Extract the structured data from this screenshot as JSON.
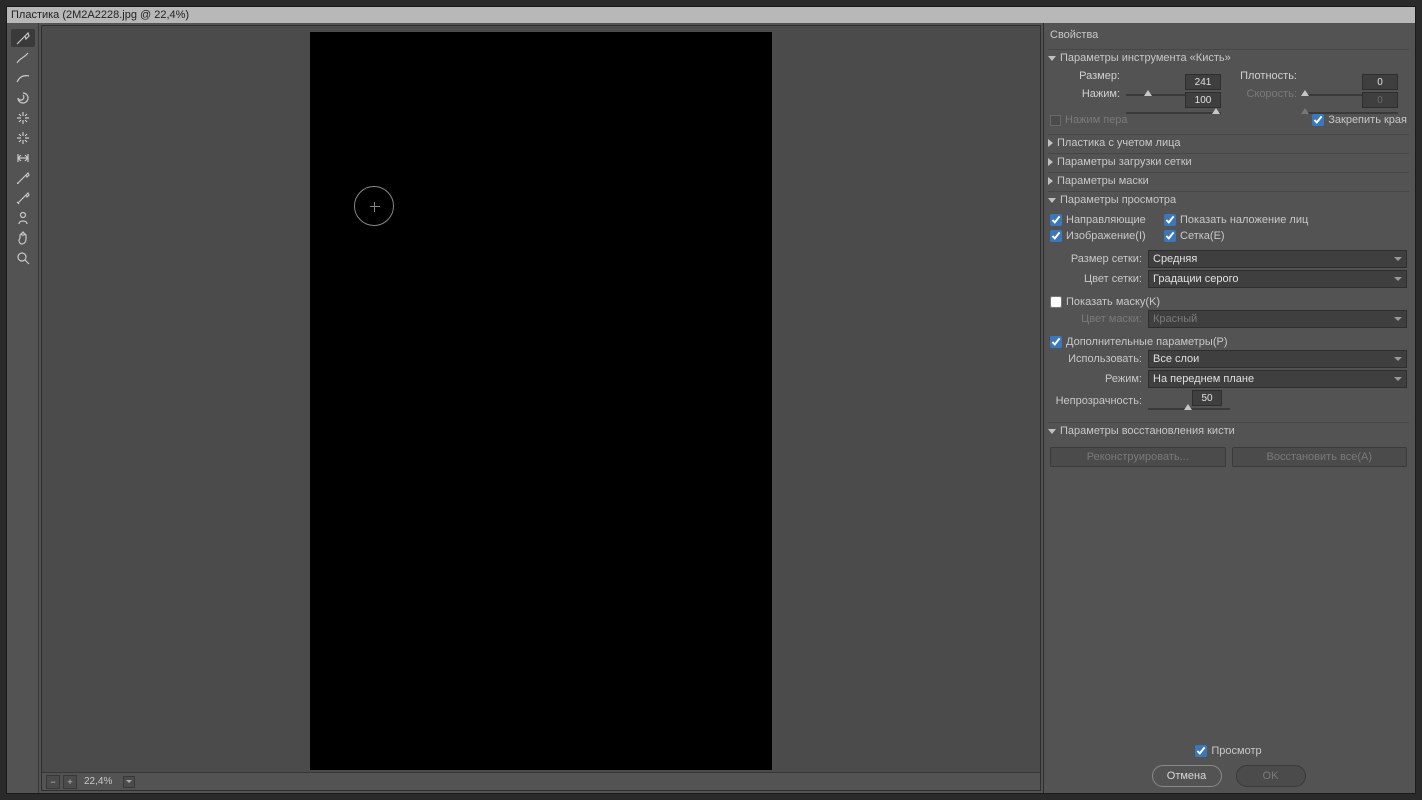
{
  "window": {
    "title": "Пластика (2M2A2228.jpg @ 22,4%)"
  },
  "tools": [
    "forward-warp",
    "reconstruct",
    "smooth",
    "twirl",
    "pucker",
    "bloat",
    "push-left",
    "freeze-mask",
    "thaw-mask",
    "face",
    "hand",
    "zoom"
  ],
  "canvas": {
    "zoom": "22,4%"
  },
  "panel": {
    "title": "Свойства",
    "brush": {
      "header": "Параметры инструмента «Кисть»",
      "size_label": "Размер:",
      "size_value": "241",
      "density_label": "Плотность:",
      "density_value": "0",
      "pressure_label": "Нажим:",
      "pressure_value": "100",
      "rate_label": "Скорость:",
      "rate_value": "0",
      "pen_pressure_label": "Нажим пера",
      "lock_edges_label": "Закрепить края"
    },
    "face_aware": {
      "header": "Пластика с учетом лица"
    },
    "load_mesh": {
      "header": "Параметры загрузки сетки"
    },
    "mask": {
      "header": "Параметры маски"
    },
    "view": {
      "header": "Параметры просмотра",
      "guides_label": "Направляющие",
      "face_overlay_label": "Показать наложение лиц",
      "image_label": "Изображение(I)",
      "mesh_label": "Сетка(E)",
      "mesh_size_label": "Размер сетки:",
      "mesh_size_value": "Средняя",
      "mesh_color_label": "Цвет сетки:",
      "mesh_color_value": "Градации серого",
      "show_mask_label": "Показать маску(K)",
      "mask_color_label": "Цвет маски:",
      "mask_color_value": "Красный",
      "additional_label": "Дополнительные параметры(P)",
      "use_label": "Использовать:",
      "use_value": "Все слои",
      "mode_label": "Режим:",
      "mode_value": "На переднем плане",
      "opacity_label": "Непрозрачность:",
      "opacity_value": "50"
    },
    "reconstruct": {
      "header": "Параметры восстановления кисти",
      "reconstruct_btn": "Реконструировать...",
      "restore_all_btn": "Восстановить все(A)"
    },
    "footer": {
      "preview_label": "Просмотр",
      "cancel": "Отмена",
      "ok": "OK"
    }
  }
}
